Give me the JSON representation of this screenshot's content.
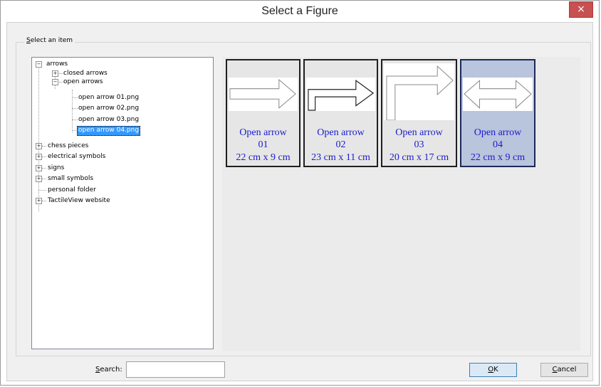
{
  "window": {
    "title": "Select a Figure",
    "close_icon": "×"
  },
  "group": {
    "label_accel": "S",
    "label_rest": "elect an item"
  },
  "tree": {
    "items": [
      {
        "label": "arrows",
        "expander": "−"
      },
      {
        "label": "closed arrows",
        "expander": "+"
      },
      {
        "label": "open arrows",
        "expander": "−"
      },
      {
        "label": "open arrow 01.png"
      },
      {
        "label": "open arrow 02.png"
      },
      {
        "label": "open arrow 03.png"
      },
      {
        "label": "open arrow 04.png",
        "selected": true
      },
      {
        "label": "chess pieces",
        "expander": "+"
      },
      {
        "label": "electrical symbols",
        "expander": "+"
      },
      {
        "label": "signs",
        "expander": "+"
      },
      {
        "label": "small symbols",
        "expander": "+"
      },
      {
        "label": "personal folder"
      },
      {
        "label": "TactileView website",
        "expander": "+"
      }
    ]
  },
  "cards": [
    {
      "name": "Open arrow",
      "number": "01",
      "size": "22 cm x 9 cm",
      "icon": "straight-arrow-icon"
    },
    {
      "name": "Open arrow",
      "number": "02",
      "size": "23 cm x 11 cm",
      "icon": "bent-arrow-icon"
    },
    {
      "name": "Open arrow",
      "number": "03",
      "size": "20 cm x 17 cm",
      "icon": "corner-arrow-icon"
    },
    {
      "name": "Open arrow",
      "number": "04",
      "size": "22 cm x 9 cm",
      "icon": "double-arrow-icon",
      "selected": true
    }
  ],
  "search": {
    "label_accel": "S",
    "label_rest": "earch:",
    "value": ""
  },
  "buttons": {
    "ok_accel": "O",
    "ok_rest": "K",
    "cancel_accel": "C",
    "cancel_rest": "ancel"
  },
  "colors": {
    "selection": "#3399ff",
    "card_text": "#1a1acc",
    "selected_card": "#b9c4dd",
    "close": "#c75050"
  }
}
